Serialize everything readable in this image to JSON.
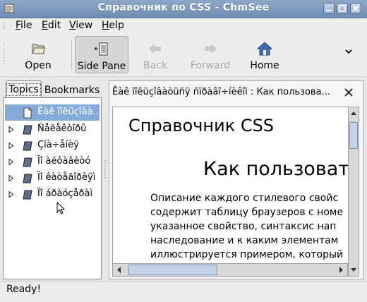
{
  "window": {
    "title": "Справочник по CSS - ChmSee"
  },
  "menubar": {
    "items": [
      {
        "label": "File",
        "mnemonic": "F"
      },
      {
        "label": "Edit",
        "mnemonic": "E"
      },
      {
        "label": "View",
        "mnemonic": "V"
      },
      {
        "label": "Help",
        "mnemonic": "H"
      }
    ]
  },
  "toolbar": {
    "open": "Open",
    "side_pane": "Side Pane",
    "back": "Back",
    "forward": "Forward",
    "home": "Home",
    "more": "⌄"
  },
  "sidepane": {
    "tabs": {
      "topics": "Topics",
      "bookmarks": "Bookmarks"
    },
    "tree": [
      {
        "label": "Êàê ïîëüçîâà...",
        "selected": true,
        "expandable": false,
        "icon": "page-icon"
      },
      {
        "label": "Ñåëåêòîðû",
        "selected": false,
        "expandable": true,
        "icon": "book-icon"
      },
      {
        "label": "Çíà÷åíèÿ",
        "selected": false,
        "expandable": true,
        "icon": "book-icon"
      },
      {
        "label": "Ïî àëôàâèòó",
        "selected": false,
        "expandable": true,
        "icon": "book-icon"
      },
      {
        "label": "Ïî êàòåãîðèÿì",
        "selected": false,
        "expandable": true,
        "icon": "book-icon"
      },
      {
        "label": "Ïî áðàóçåðàì",
        "selected": false,
        "expandable": true,
        "icon": "book-icon"
      }
    ]
  },
  "document": {
    "tab_title": "Êàê ïîëüçîâàòüñÿ ñïðàâî÷íèêîì : Как пользова...",
    "h1": "Справочник CSS",
    "h2": "Как пользовать",
    "paragraph_lines": [
      "Описание каждого стилевого свойс",
      "содержит таблицу браузеров с номе",
      "указанное свойство, синтаксис нап",
      "наследование и к каким элементам",
      "иллюстрируется примером, который"
    ]
  },
  "status": {
    "text": "Ready!"
  },
  "colors": {
    "titlebar": "#7d9abf",
    "selection": "#86abd9",
    "home_blue": "#3d6db0"
  }
}
